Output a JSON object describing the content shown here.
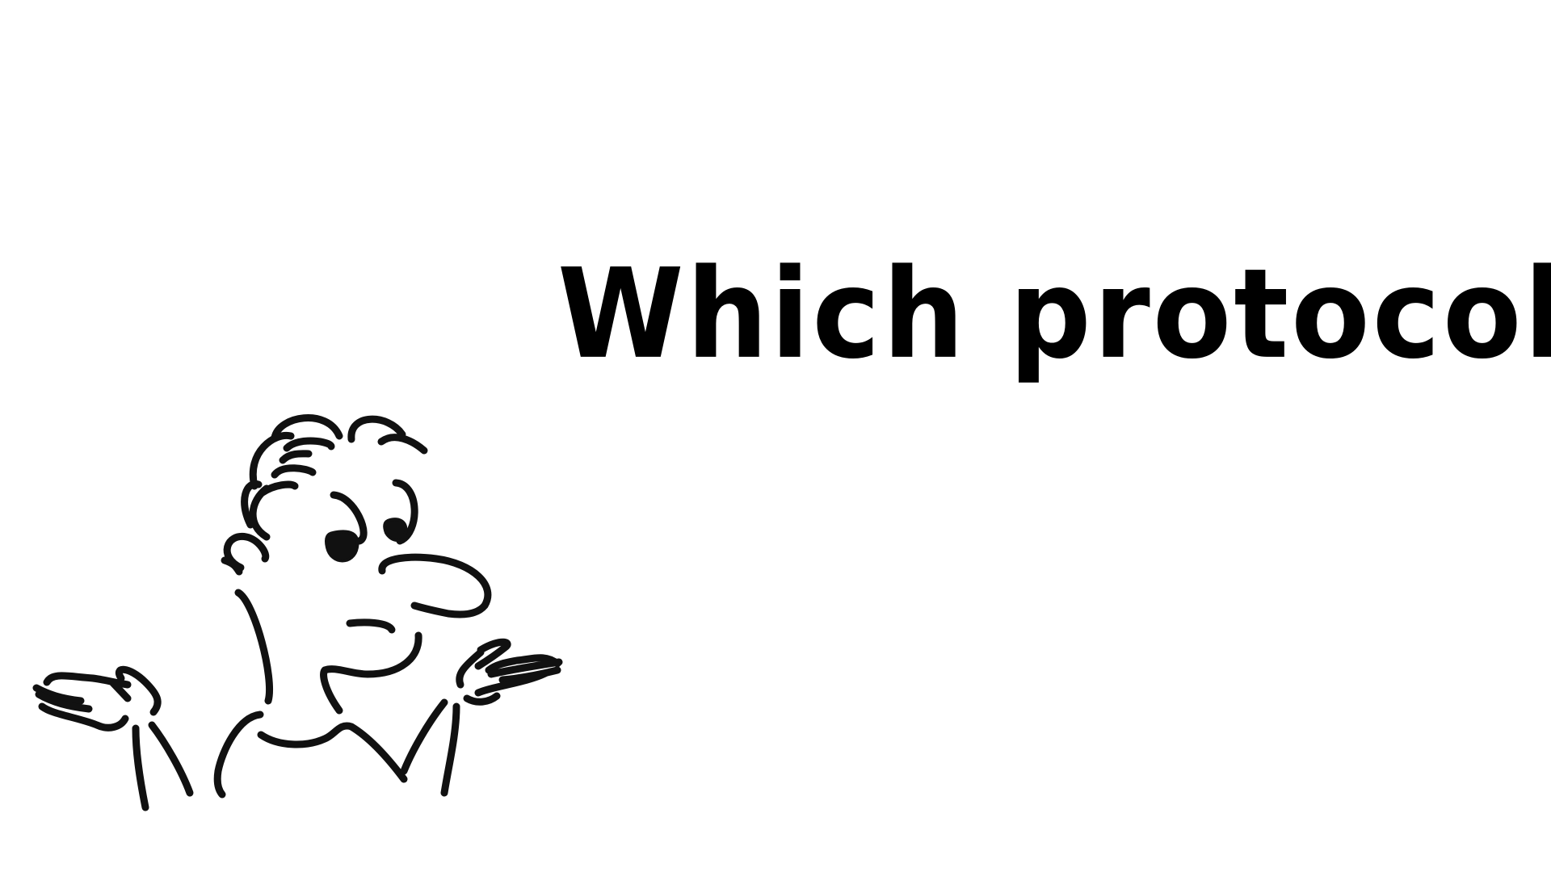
{
  "slide": {
    "headline": "Which protocol?",
    "illustration": "shrugging-person-icon",
    "colors": {
      "background": "#ffffff",
      "ink": "#000000"
    }
  }
}
